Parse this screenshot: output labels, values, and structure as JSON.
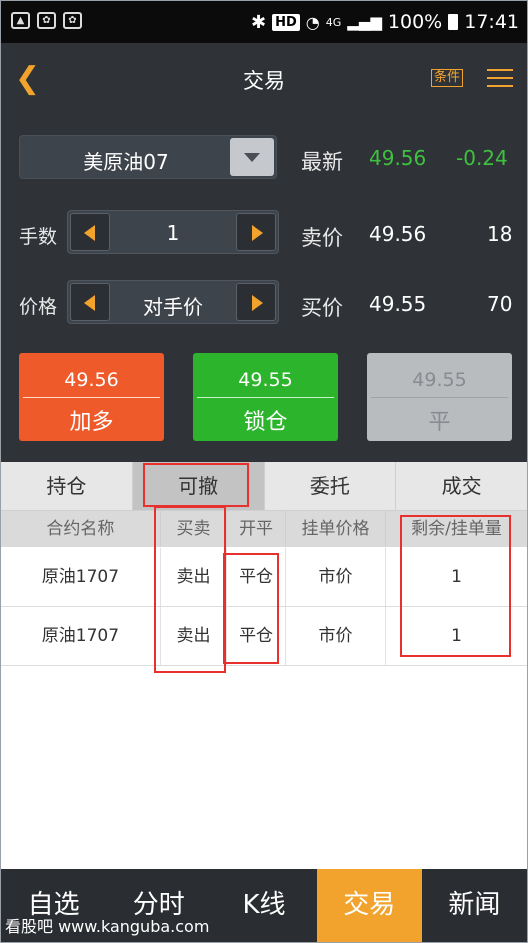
{
  "status_bar": {
    "network": "4G",
    "battery": "100%",
    "time": "17:41",
    "hd": "HD"
  },
  "header": {
    "title": "交易",
    "condition_label": "条件",
    "back_icon": "chevron-left-icon",
    "menu_icon": "hamburger-icon"
  },
  "trade": {
    "contract": "美原油07",
    "latest_label": "最新",
    "latest_price": "49.56",
    "change": "-0.24",
    "qty_label": "手数",
    "qty_value": "1",
    "sell_label": "卖价",
    "sell_price": "49.56",
    "sell_qty": "18",
    "price_label": "价格",
    "price_value": "对手价",
    "buy_label": "买价",
    "buy_price": "49.55",
    "buy_qty": "70",
    "colors": {
      "up": "#3ec13e",
      "sell_btn": "#ef5a2b",
      "buy_btn": "#2cb52c",
      "close_btn": "#b9bcbf",
      "accent": "#f2a32e"
    }
  },
  "buttons": {
    "add_long": {
      "price": "49.56",
      "label": "加多"
    },
    "lock": {
      "price": "49.55",
      "label": "锁仓"
    },
    "close": {
      "price": "49.55",
      "label": "平"
    }
  },
  "tabs": [
    "持仓",
    "可撤",
    "委托",
    "成交"
  ],
  "table": {
    "headers": [
      "合约名称",
      "买卖",
      "开平",
      "挂单价格",
      "剩余/挂单量"
    ],
    "rows": [
      [
        "原油1707",
        "卖出",
        "平仓",
        "市价",
        "1"
      ],
      [
        "原油1707",
        "卖出",
        "平仓",
        "市价",
        "1"
      ]
    ]
  },
  "bottom_nav": [
    "自选",
    "分时",
    "K线",
    "交易",
    "新闻"
  ],
  "watermark": "看股吧 www.kanguba.com"
}
